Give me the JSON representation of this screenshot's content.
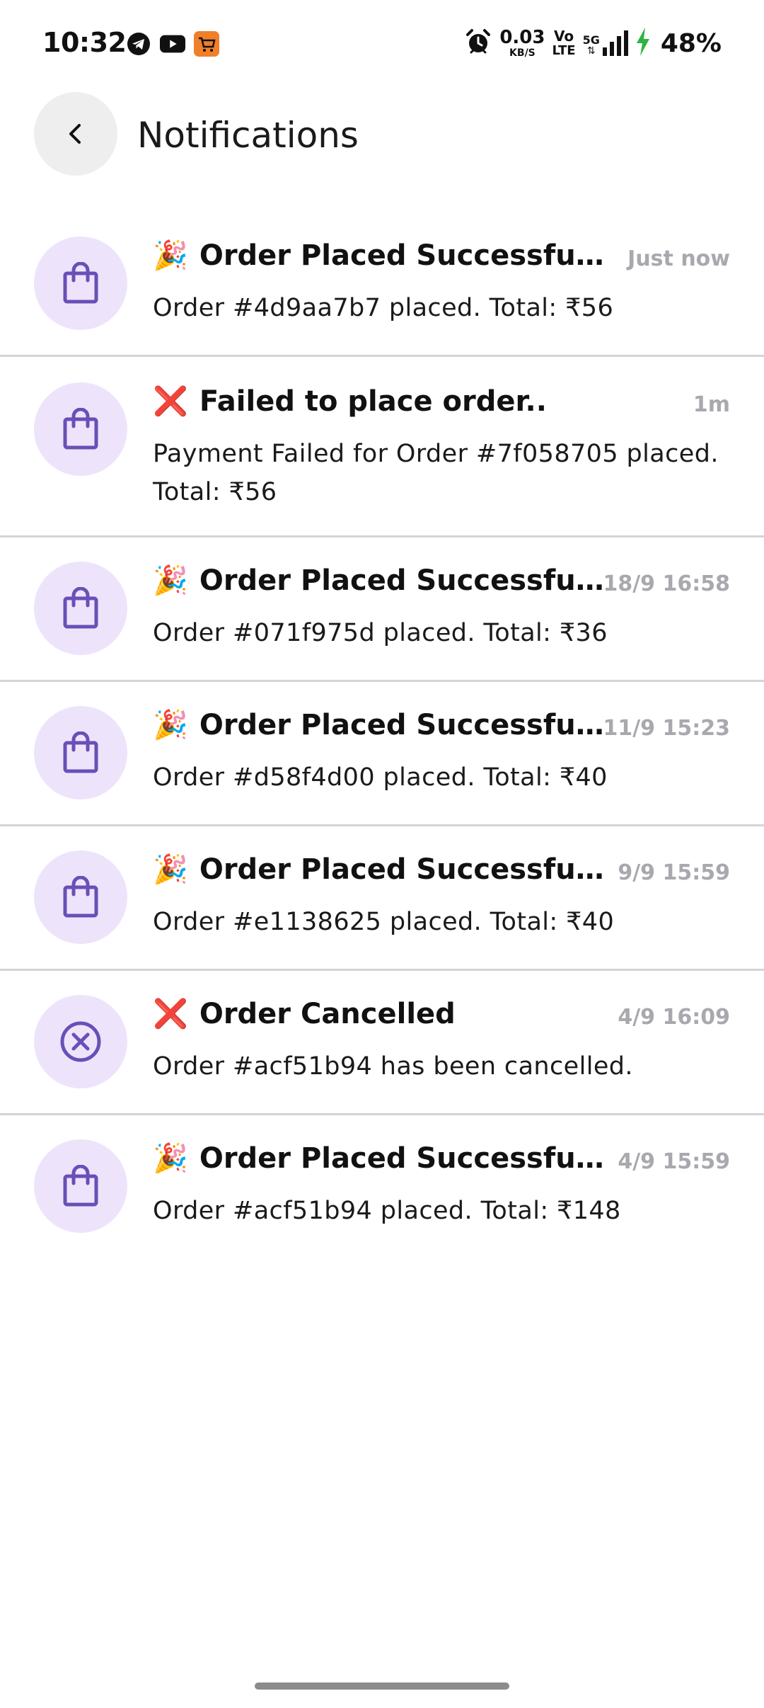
{
  "status_bar": {
    "time": "10:32",
    "net_speed_value": "0.03",
    "net_speed_unit": "KB/S",
    "volte_top": "Vo",
    "volte_bottom": "LTE",
    "network_type": "5G",
    "battery": "48%",
    "icons": [
      "telegram-icon",
      "youtube-icon",
      "shop-app-icon",
      "alarm-icon",
      "signal-icon",
      "charging-icon"
    ],
    "colors": {
      "charging": "#2fb344",
      "shop_app": "#f07f2a"
    }
  },
  "header": {
    "title": "Notifications",
    "back_icon": "chevron-left-icon"
  },
  "colors": {
    "avatar_bg": "#ede4fc",
    "icon_purple": "#6a4fb6",
    "time_gray": "#a8a8ae",
    "divider": "#d4d4d8"
  },
  "notifications": [
    {
      "emoji": "🎉",
      "title": "Order Placed Successfully!",
      "time": "Just now",
      "body": "Order #4d9aa7b7 placed. Total: ₹56",
      "icon": "shopping-bag-icon"
    },
    {
      "emoji": "❌",
      "title": "Failed to place order..",
      "time": "1m",
      "body": "Payment Failed for Order #7f058705 placed. Total: ₹56",
      "icon": "shopping-bag-icon"
    },
    {
      "emoji": "🎉",
      "title": "Order Placed Successfull...",
      "time": "18/9 16:58",
      "body": "Order #071f975d placed. Total: ₹36",
      "icon": "shopping-bag-icon"
    },
    {
      "emoji": "🎉",
      "title": "Order Placed Successfull...",
      "time": "11/9 15:23",
      "body": "Order #d58f4d00 placed. Total: ₹40",
      "icon": "shopping-bag-icon"
    },
    {
      "emoji": "🎉",
      "title": "Order Placed Successfully!",
      "time": "9/9 15:59",
      "body": "Order #e1138625 placed. Total: ₹40",
      "icon": "shopping-bag-icon"
    },
    {
      "emoji": "❌",
      "title": "Order Cancelled",
      "time": "4/9 16:09",
      "body": "Order #acf51b94 has been cancelled.",
      "icon": "cancel-circle-icon"
    },
    {
      "emoji": "🎉",
      "title": "Order Placed Successfully!",
      "time": "4/9 15:59",
      "body": "Order #acf51b94 placed. Total: ₹148",
      "icon": "shopping-bag-icon"
    }
  ]
}
